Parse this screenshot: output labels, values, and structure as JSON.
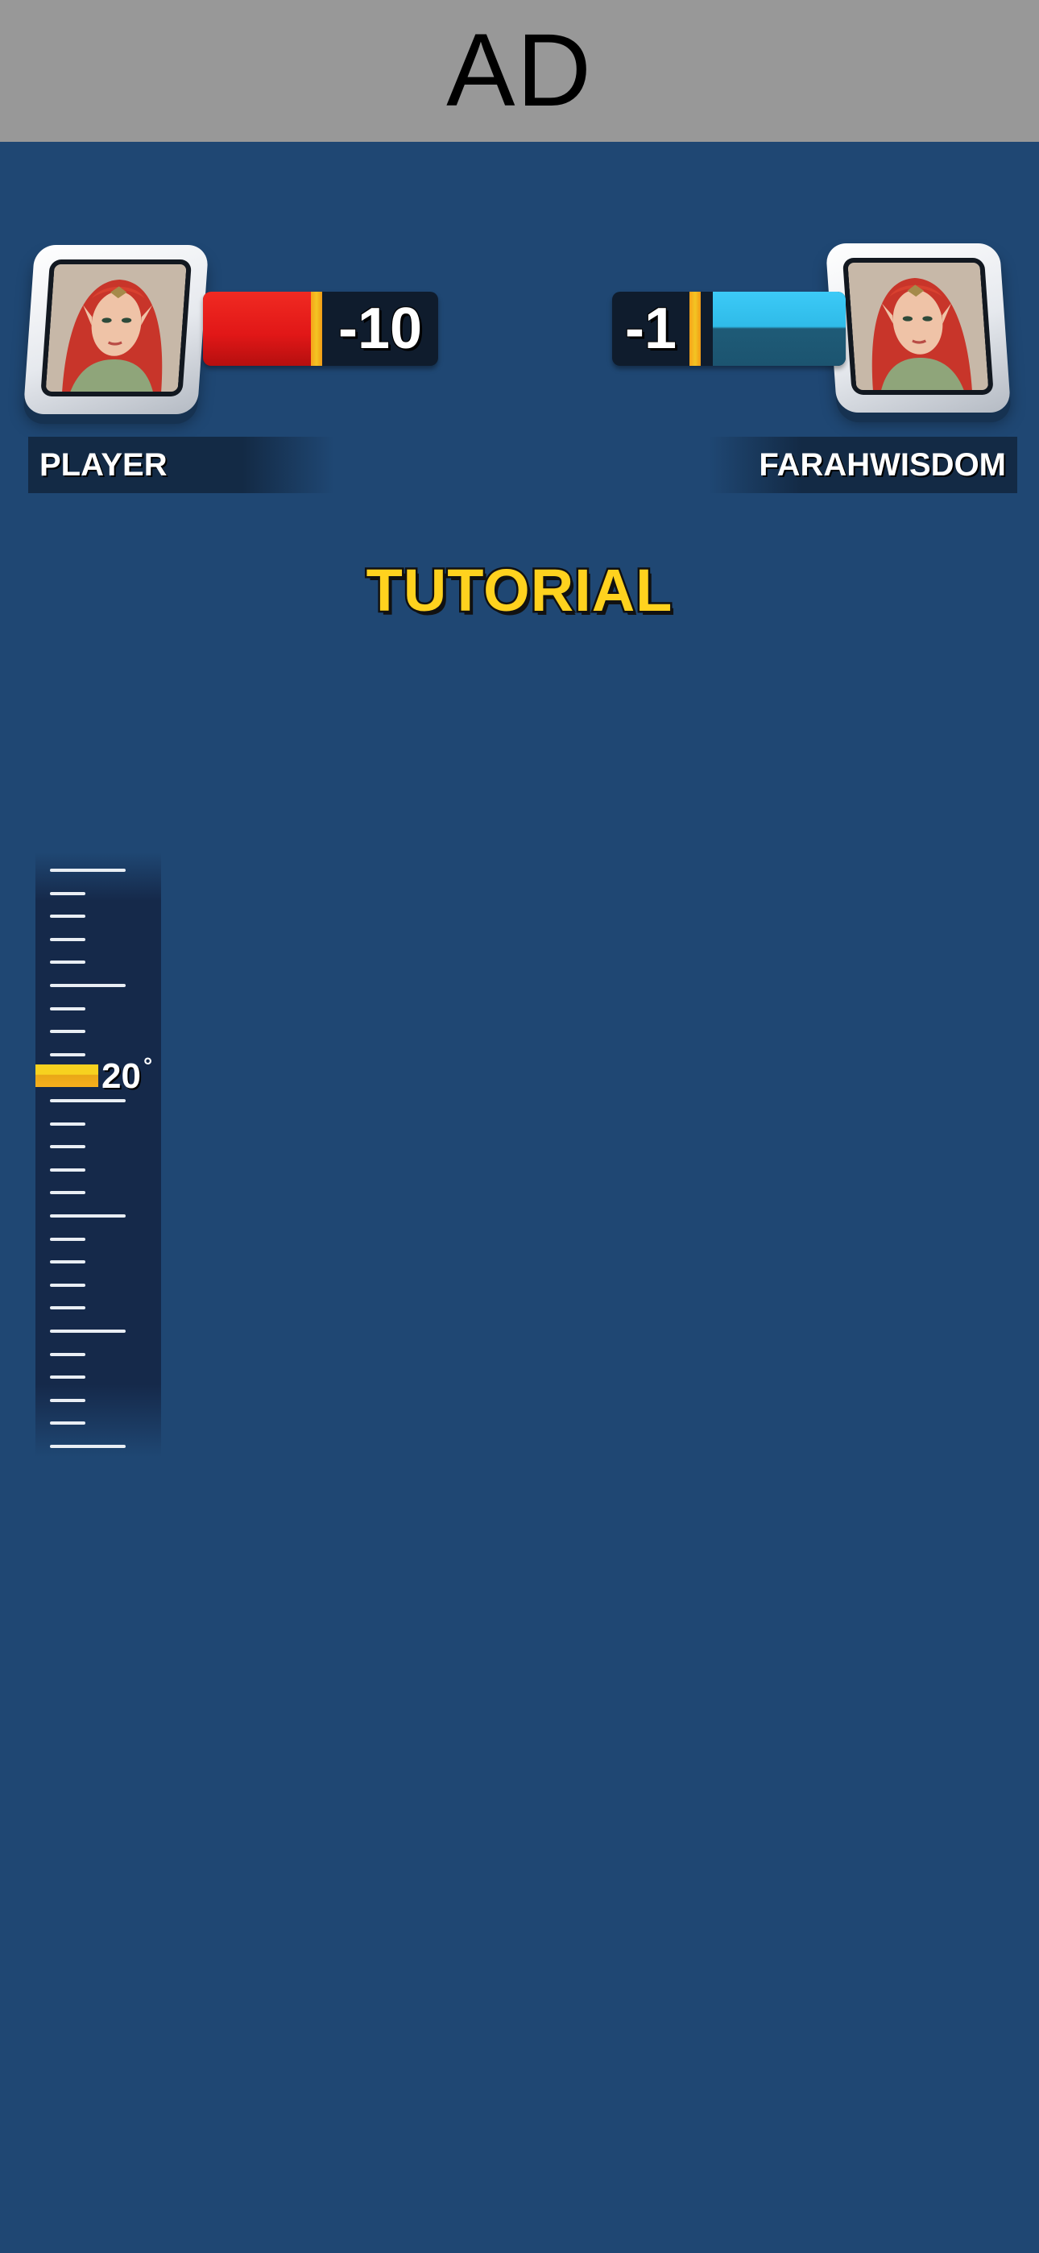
{
  "ad": {
    "label": "AD"
  },
  "player": {
    "name": "PLAYER",
    "score": "-10",
    "bar_color": "#e11717",
    "avatar_icon": "elf-portrait-icon"
  },
  "opponent": {
    "name": "FARAHWISDOM",
    "score": "-1",
    "bar_color": "#2fbbe8",
    "avatar_icon": "elf-portrait-icon"
  },
  "title": "TUTORIAL",
  "gauge": {
    "angle_value": "20",
    "degree_symbol": "°",
    "marker_color": "#f7d21f"
  },
  "colors": {
    "background": "#1f4773",
    "ad_banner": "#989898",
    "title_yellow": "#ffd21e"
  }
}
